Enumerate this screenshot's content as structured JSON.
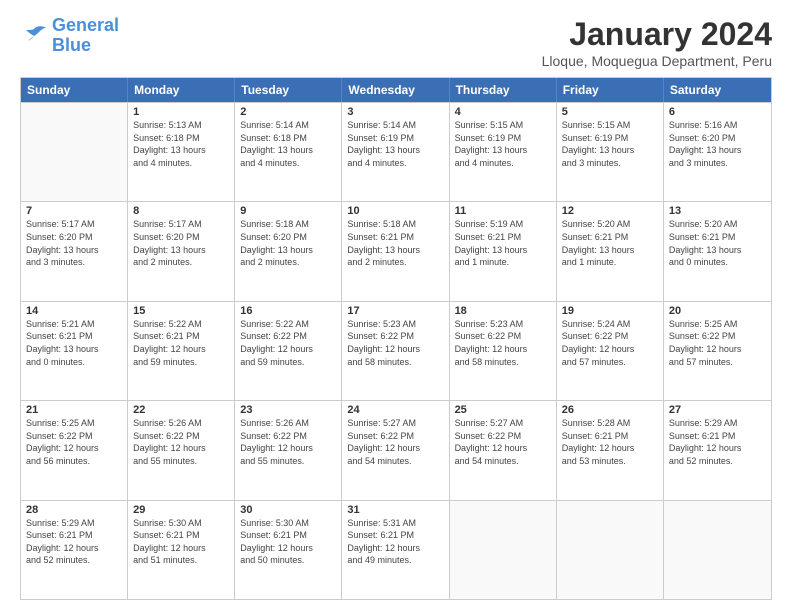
{
  "logo": {
    "line1": "General",
    "line2": "Blue"
  },
  "title": "January 2024",
  "subtitle": "Lloque, Moquegua Department, Peru",
  "header_days": [
    "Sunday",
    "Monday",
    "Tuesday",
    "Wednesday",
    "Thursday",
    "Friday",
    "Saturday"
  ],
  "weeks": [
    [
      {
        "day": "",
        "info": ""
      },
      {
        "day": "1",
        "info": "Sunrise: 5:13 AM\nSunset: 6:18 PM\nDaylight: 13 hours\nand 4 minutes."
      },
      {
        "day": "2",
        "info": "Sunrise: 5:14 AM\nSunset: 6:18 PM\nDaylight: 13 hours\nand 4 minutes."
      },
      {
        "day": "3",
        "info": "Sunrise: 5:14 AM\nSunset: 6:19 PM\nDaylight: 13 hours\nand 4 minutes."
      },
      {
        "day": "4",
        "info": "Sunrise: 5:15 AM\nSunset: 6:19 PM\nDaylight: 13 hours\nand 4 minutes."
      },
      {
        "day": "5",
        "info": "Sunrise: 5:15 AM\nSunset: 6:19 PM\nDaylight: 13 hours\nand 3 minutes."
      },
      {
        "day": "6",
        "info": "Sunrise: 5:16 AM\nSunset: 6:20 PM\nDaylight: 13 hours\nand 3 minutes."
      }
    ],
    [
      {
        "day": "7",
        "info": "Sunrise: 5:17 AM\nSunset: 6:20 PM\nDaylight: 13 hours\nand 3 minutes."
      },
      {
        "day": "8",
        "info": "Sunrise: 5:17 AM\nSunset: 6:20 PM\nDaylight: 13 hours\nand 2 minutes."
      },
      {
        "day": "9",
        "info": "Sunrise: 5:18 AM\nSunset: 6:20 PM\nDaylight: 13 hours\nand 2 minutes."
      },
      {
        "day": "10",
        "info": "Sunrise: 5:18 AM\nSunset: 6:21 PM\nDaylight: 13 hours\nand 2 minutes."
      },
      {
        "day": "11",
        "info": "Sunrise: 5:19 AM\nSunset: 6:21 PM\nDaylight: 13 hours\nand 1 minute."
      },
      {
        "day": "12",
        "info": "Sunrise: 5:20 AM\nSunset: 6:21 PM\nDaylight: 13 hours\nand 1 minute."
      },
      {
        "day": "13",
        "info": "Sunrise: 5:20 AM\nSunset: 6:21 PM\nDaylight: 13 hours\nand 0 minutes."
      }
    ],
    [
      {
        "day": "14",
        "info": "Sunrise: 5:21 AM\nSunset: 6:21 PM\nDaylight: 13 hours\nand 0 minutes."
      },
      {
        "day": "15",
        "info": "Sunrise: 5:22 AM\nSunset: 6:21 PM\nDaylight: 12 hours\nand 59 minutes."
      },
      {
        "day": "16",
        "info": "Sunrise: 5:22 AM\nSunset: 6:22 PM\nDaylight: 12 hours\nand 59 minutes."
      },
      {
        "day": "17",
        "info": "Sunrise: 5:23 AM\nSunset: 6:22 PM\nDaylight: 12 hours\nand 58 minutes."
      },
      {
        "day": "18",
        "info": "Sunrise: 5:23 AM\nSunset: 6:22 PM\nDaylight: 12 hours\nand 58 minutes."
      },
      {
        "day": "19",
        "info": "Sunrise: 5:24 AM\nSunset: 6:22 PM\nDaylight: 12 hours\nand 57 minutes."
      },
      {
        "day": "20",
        "info": "Sunrise: 5:25 AM\nSunset: 6:22 PM\nDaylight: 12 hours\nand 57 minutes."
      }
    ],
    [
      {
        "day": "21",
        "info": "Sunrise: 5:25 AM\nSunset: 6:22 PM\nDaylight: 12 hours\nand 56 minutes."
      },
      {
        "day": "22",
        "info": "Sunrise: 5:26 AM\nSunset: 6:22 PM\nDaylight: 12 hours\nand 55 minutes."
      },
      {
        "day": "23",
        "info": "Sunrise: 5:26 AM\nSunset: 6:22 PM\nDaylight: 12 hours\nand 55 minutes."
      },
      {
        "day": "24",
        "info": "Sunrise: 5:27 AM\nSunset: 6:22 PM\nDaylight: 12 hours\nand 54 minutes."
      },
      {
        "day": "25",
        "info": "Sunrise: 5:27 AM\nSunset: 6:22 PM\nDaylight: 12 hours\nand 54 minutes."
      },
      {
        "day": "26",
        "info": "Sunrise: 5:28 AM\nSunset: 6:21 PM\nDaylight: 12 hours\nand 53 minutes."
      },
      {
        "day": "27",
        "info": "Sunrise: 5:29 AM\nSunset: 6:21 PM\nDaylight: 12 hours\nand 52 minutes."
      }
    ],
    [
      {
        "day": "28",
        "info": "Sunrise: 5:29 AM\nSunset: 6:21 PM\nDaylight: 12 hours\nand 52 minutes."
      },
      {
        "day": "29",
        "info": "Sunrise: 5:30 AM\nSunset: 6:21 PM\nDaylight: 12 hours\nand 51 minutes."
      },
      {
        "day": "30",
        "info": "Sunrise: 5:30 AM\nSunset: 6:21 PM\nDaylight: 12 hours\nand 50 minutes."
      },
      {
        "day": "31",
        "info": "Sunrise: 5:31 AM\nSunset: 6:21 PM\nDaylight: 12 hours\nand 49 minutes."
      },
      {
        "day": "",
        "info": ""
      },
      {
        "day": "",
        "info": ""
      },
      {
        "day": "",
        "info": ""
      }
    ]
  ]
}
